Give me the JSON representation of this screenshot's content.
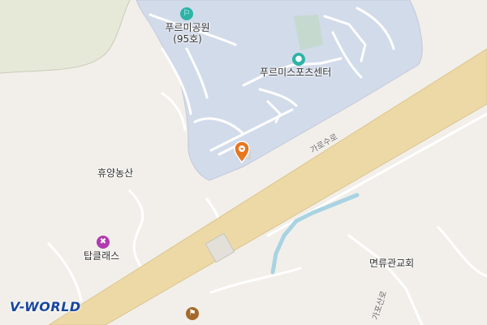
{
  "map": {
    "places": {
      "park": {
        "name": "푸르미공원",
        "sub": "(95호)"
      },
      "sports_center": {
        "name": "푸르미스포츠센터"
      },
      "farm": {
        "name": "휴양농산"
      },
      "top_class": {
        "name": "탑클래스"
      },
      "church": {
        "name": "면류관교회"
      }
    },
    "roads": {
      "main": "가로수로",
      "side": "가포산로"
    },
    "logo": "V-WORLD",
    "colors": {
      "background": "#f2efea",
      "park_area": "#d2dbea",
      "hill_area": "#e6e9d7",
      "main_road": "#ecd9a6",
      "water": "#a9d3e2",
      "park_icon": "#2db4a6",
      "shop_icon": "#b23ab0",
      "marker": "#e8761f"
    }
  }
}
